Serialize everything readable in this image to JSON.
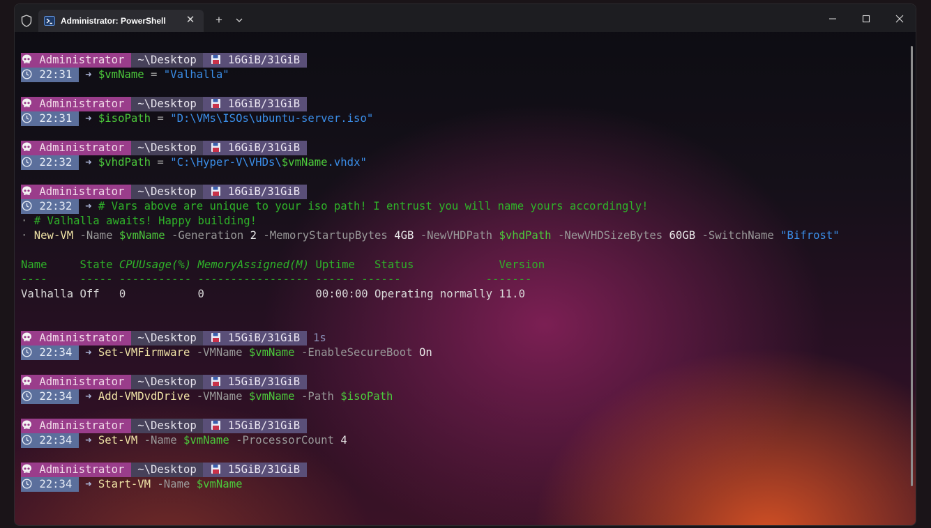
{
  "titlebar": {
    "tab_title": "Administrator: PowerShell",
    "close_tab_glyph": "✕",
    "new_tab_glyph": "+"
  },
  "icons": {
    "shield": "shield-icon",
    "tab": "powershell-icon",
    "skull": "skull-icon",
    "floppy": "floppy-disk-icon",
    "clock": "clock-icon"
  },
  "colors": {
    "user_segment": "#9a3d8b",
    "dir_segment": "#47415a",
    "mem_segment": "#5a4f78",
    "time_segment": "#5b6f9c",
    "variable": "#4cc93b",
    "string": "#3b8ee8",
    "command": "#f0e3a6"
  },
  "prompts": [
    {
      "user": "Administrator",
      "dir": "~\\Desktop",
      "mem": "16GiB/31GiB",
      "duration": "",
      "time": "22:31"
    },
    {
      "user": "Administrator",
      "dir": "~\\Desktop",
      "mem": "16GiB/31GiB",
      "duration": "",
      "time": "22:31"
    },
    {
      "user": "Administrator",
      "dir": "~\\Desktop",
      "mem": "16GiB/31GiB",
      "duration": "",
      "time": "22:32"
    },
    {
      "user": "Administrator",
      "dir": "~\\Desktop",
      "mem": "16GiB/31GiB",
      "duration": "",
      "time": "22:32"
    },
    {
      "user": "Administrator",
      "dir": "~\\Desktop",
      "mem": "15GiB/31GiB",
      "duration": "1s",
      "time": "22:34"
    },
    {
      "user": "Administrator",
      "dir": "~\\Desktop",
      "mem": "15GiB/31GiB",
      "duration": "",
      "time": "22:34"
    },
    {
      "user": "Administrator",
      "dir": "~\\Desktop",
      "mem": "15GiB/31GiB",
      "duration": "",
      "time": "22:34"
    },
    {
      "user": "Administrator",
      "dir": "~\\Desktop",
      "mem": "15GiB/31GiB",
      "duration": "",
      "time": "22:34"
    }
  ],
  "commands": {
    "c1": {
      "var": "$vmName",
      "op": "=",
      "str": "\"Valhalla\""
    },
    "c2": {
      "var": "$isoPath",
      "op": "=",
      "str": "\"D:\\VMs\\ISOs\\ubuntu-server.iso\""
    },
    "c3": {
      "var": "$vhdPath",
      "op": "=",
      "str_a": "\"C:\\Hyper-V\\VHDs\\",
      "var2": "$vmName",
      "str_b": ".vhdx\""
    },
    "c4": {
      "comment1": "# Vars above are unique to your iso path! I entrust you will name yours accordingly!",
      "dot": "·",
      "comment2": "# Valhalla awaits! Happy building!",
      "cmd": "New-VM",
      "p1": "-Name",
      "v1": "$vmName",
      "p2": "-Generation",
      "n2": "2",
      "p3": "-MemoryStartupBytes",
      "n3": "4GB",
      "p4": "-NewVHDPath",
      "v4": "$vhdPath",
      "p5": "-NewVHDSizeBytes",
      "n5": "60GB",
      "p6": "-SwitchName",
      "s6": "\"Bifrost\""
    },
    "c5": {
      "cmd": "Set-VMFirmware",
      "p1": "-VMName",
      "v1": "$vmName",
      "p2": "-EnableSecureBoot",
      "n2": "On"
    },
    "c6": {
      "cmd": "Add-VMDvdDrive",
      "p1": "-VMName",
      "v1": "$vmName",
      "p2": "-Path",
      "v2": "$isoPath"
    },
    "c7": {
      "cmd": "Set-VM",
      "p1": "-Name",
      "v1": "$vmName",
      "p2": "-ProcessorCount",
      "n2": "4"
    },
    "c8": {
      "cmd": "Start-VM",
      "p1": "-Name",
      "v1": "$vmName"
    }
  },
  "arrow": "➜",
  "vm_table": {
    "headers": [
      "Name",
      "State",
      "CPUUsage(%)",
      "MemoryAssigned(M)",
      "Uptime",
      "Status",
      "Version"
    ],
    "separators": [
      "----",
      "-----",
      "-----------",
      "-----------------",
      "------",
      "------",
      "-------"
    ],
    "row": [
      "Valhalla",
      "Off",
      "0",
      "0",
      "00:00:00",
      "Operating normally",
      "11.0"
    ]
  }
}
